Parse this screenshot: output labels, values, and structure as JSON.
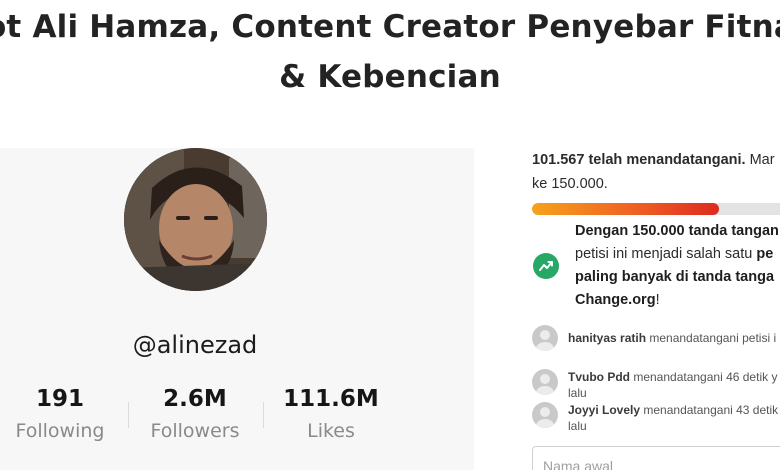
{
  "page": {
    "title_line1": "ot Ali Hamza, Content Creator Penyebar Fitna",
    "title_line2": "& Kebencian"
  },
  "profile": {
    "handle": "@alinezad",
    "stats": [
      {
        "value": "191",
        "label": "Following"
      },
      {
        "value": "2.6M",
        "label": "Followers"
      },
      {
        "value": "111.6M",
        "label": "Likes"
      }
    ]
  },
  "petition": {
    "signed_count": "101.567 telah menandatangani.",
    "signed_rest": " Mar",
    "signed_line2": "ke 150.000.",
    "progress_fraction": 0.72,
    "goal_part1": "Dengan 150.000 tanda tangan",
    "goal_part2": "petisi ini menjadi salah satu ",
    "goal_part3": "pe",
    "goal_part4": "paling banyak di tanda tanga",
    "goal_part5": "Change.org",
    "goal_part6": "!",
    "icon": "trending-up-icon",
    "accent_color": "#27a866"
  },
  "signers": [
    {
      "name": "hanityas ratih",
      "action": " menandatangani petisi i",
      "line2": ""
    },
    {
      "name": "Tvubo Pdd",
      "action": " menandatangani 46 detik y",
      "line2": "lalu"
    },
    {
      "name": "Joyyi Lovely",
      "action": " menandatangani 43 detik",
      "line2": "lalu"
    }
  ],
  "form": {
    "first_name_placeholder": "Nama awal"
  }
}
